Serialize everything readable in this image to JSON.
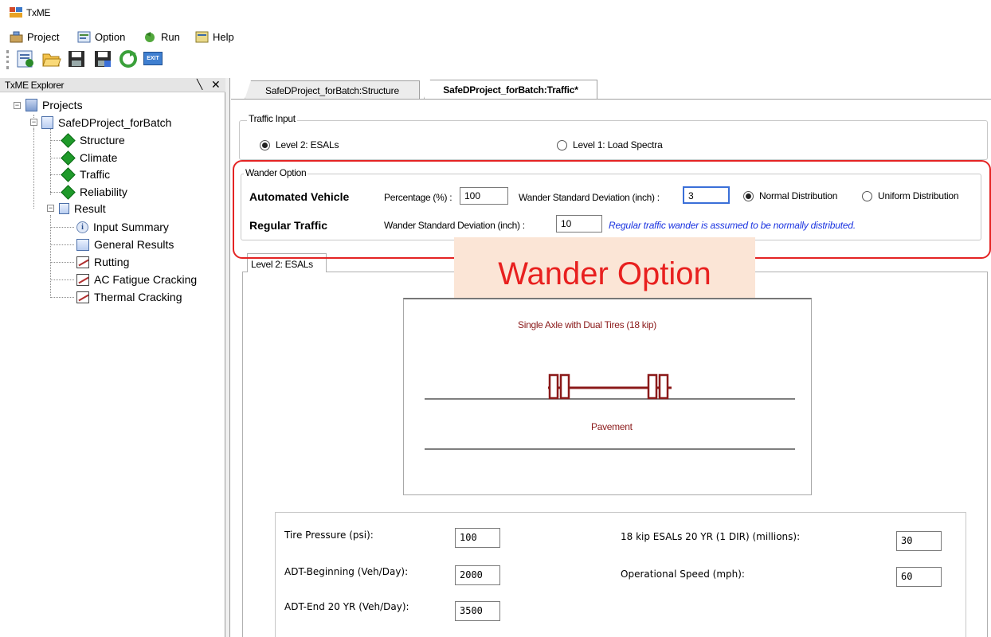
{
  "window": {
    "title": "TxME",
    "icon": "txme-app-icon"
  },
  "menu": {
    "items": [
      {
        "label": "Project",
        "icon": "project-icon"
      },
      {
        "label": "Option",
        "icon": "option-icon"
      },
      {
        "label": "Run",
        "icon": "run-icon"
      },
      {
        "label": "Help",
        "icon": "help-icon"
      }
    ]
  },
  "toolbar": {
    "buttons": [
      "new-project-icon",
      "open-folder-icon",
      "save-icon",
      "save-as-icon",
      "refresh-icon",
      "exit-icon"
    ],
    "exit_label": "EXIT"
  },
  "explorer": {
    "title": "TxME Explorer",
    "pin": "▕",
    "close": "✕",
    "tree": {
      "root": "Projects",
      "project": "SafeDProject_forBatch",
      "project_items": [
        "Structure",
        "Climate",
        "Traffic",
        "Reliability"
      ],
      "result": "Result",
      "result_items": [
        "Input Summary",
        "General Results",
        "Rutting",
        "AC Fatigue Cracking",
        "Thermal Cracking"
      ]
    }
  },
  "tabs": [
    {
      "label": "SafeDProject_forBatch:Structure",
      "active": false
    },
    {
      "label": "SafeDProject_forBatch:Traffic*",
      "active": true
    }
  ],
  "traffic_input": {
    "title": "Traffic Input",
    "options": [
      {
        "label": "Level 2: ESALs",
        "selected": true
      },
      {
        "label": "Level 1: Load Spectra",
        "selected": false
      }
    ]
  },
  "wander": {
    "title": "Wander Option",
    "automated": {
      "label": "Automated Vehicle",
      "percentage_label": "Percentage (%) :",
      "percentage_value": "100",
      "sd_label": "Wander Standard Deviation (inch) :",
      "sd_value": "3",
      "dist_options": [
        {
          "label": "Normal Distribution",
          "selected": true
        },
        {
          "label": "Uniform Distribution",
          "selected": false
        }
      ]
    },
    "regular": {
      "label": "Regular Traffic",
      "sd_label": "Wander Standard Deviation (inch) :",
      "sd_value": "10",
      "note": "Regular traffic wander is assumed to be normally distributed."
    }
  },
  "annotation": {
    "text": "Wander Option"
  },
  "subtab": {
    "label": "Level 2: ESALs"
  },
  "diagram": {
    "title": "Single Axle with Dual Tires (18 kip)",
    "pavement_label": "Pavement"
  },
  "inputs": {
    "tire_pressure": {
      "label": "Tire Pressure (psi):",
      "value": "100"
    },
    "adt_begin": {
      "label": "ADT-Beginning (Veh/Day):",
      "value": "2000"
    },
    "adt_end": {
      "label": "ADT-End 20 YR (Veh/Day):",
      "value": "3500"
    },
    "esals": {
      "label": "18 kip ESALs 20 YR (1 DIR) (millions):",
      "value": "30"
    },
    "speed": {
      "label": "Operational Speed (mph):",
      "value": "60"
    }
  },
  "colors": {
    "highlight": "#e42323",
    "annotation_bg": "#fbe5d6",
    "note_text": "#1a33e0",
    "diagram": "#8b1a1a",
    "tree_diamond": "#1f9a2a"
  }
}
